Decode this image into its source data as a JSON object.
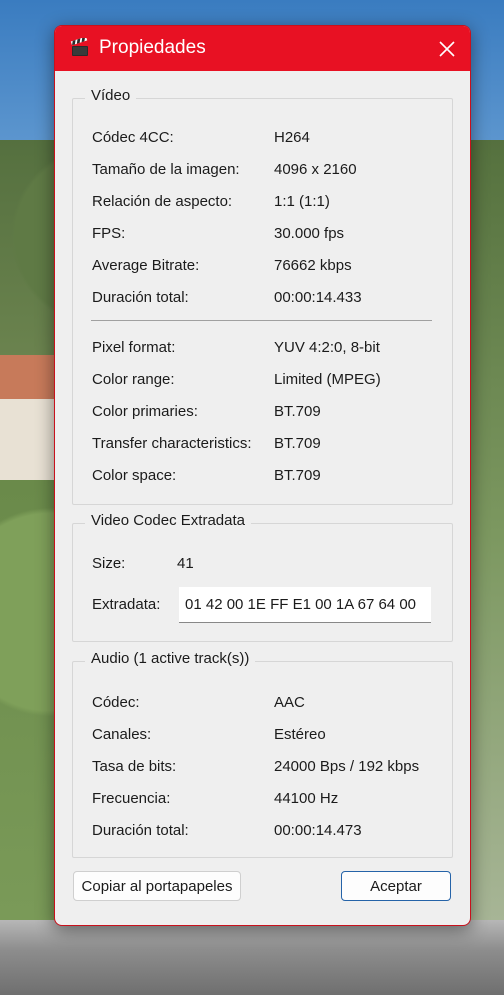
{
  "window": {
    "title": "Propiedades",
    "icon": "clapperboard-icon",
    "close_icon": "close-icon",
    "accent": "#e81123"
  },
  "video": {
    "legend": "Vídeo",
    "rows": [
      {
        "label": "Códec 4CC:",
        "value": "H264"
      },
      {
        "label": "Tamaño de la imagen:",
        "value": "4096 x 2160"
      },
      {
        "label": "Relación de aspecto:",
        "value": "1:1 (1:1)"
      },
      {
        "label": "FPS:",
        "value": "30.000 fps"
      },
      {
        "label": "Average Bitrate:",
        "value": "76662 kbps"
      },
      {
        "label": "Duración total:",
        "value": "00:00:14.433"
      },
      {
        "label": "Pixel format:",
        "value": "YUV 4:2:0, 8-bit"
      },
      {
        "label": "Color range:",
        "value": "Limited (MPEG)"
      },
      {
        "label": "Color primaries:",
        "value": "BT.709"
      },
      {
        "label": "Transfer characteristics:",
        "value": "BT.709"
      },
      {
        "label": "Color space:",
        "value": "BT.709"
      }
    ]
  },
  "codec_extradata": {
    "legend": "Video Codec Extradata",
    "size_label": "Size:",
    "size_value": "41",
    "extradata_label": "Extradata:",
    "extradata_value": "01 42 00 1E FF E1 00 1A 67 64 00"
  },
  "audio": {
    "legend": "Audio (1 active track(s))",
    "rows": [
      {
        "label": "Códec:",
        "value": "AAC"
      },
      {
        "label": "Canales:",
        "value": "Estéreo"
      },
      {
        "label": "Tasa de bits:",
        "value": "24000 Bps / 192 kbps"
      },
      {
        "label": "Frecuencia:",
        "value": "44100 Hz"
      },
      {
        "label": "Duración total:",
        "value": "00:00:14.473"
      }
    ]
  },
  "buttons": {
    "copy": "Copiar al portapapeles",
    "ok": "Aceptar"
  }
}
